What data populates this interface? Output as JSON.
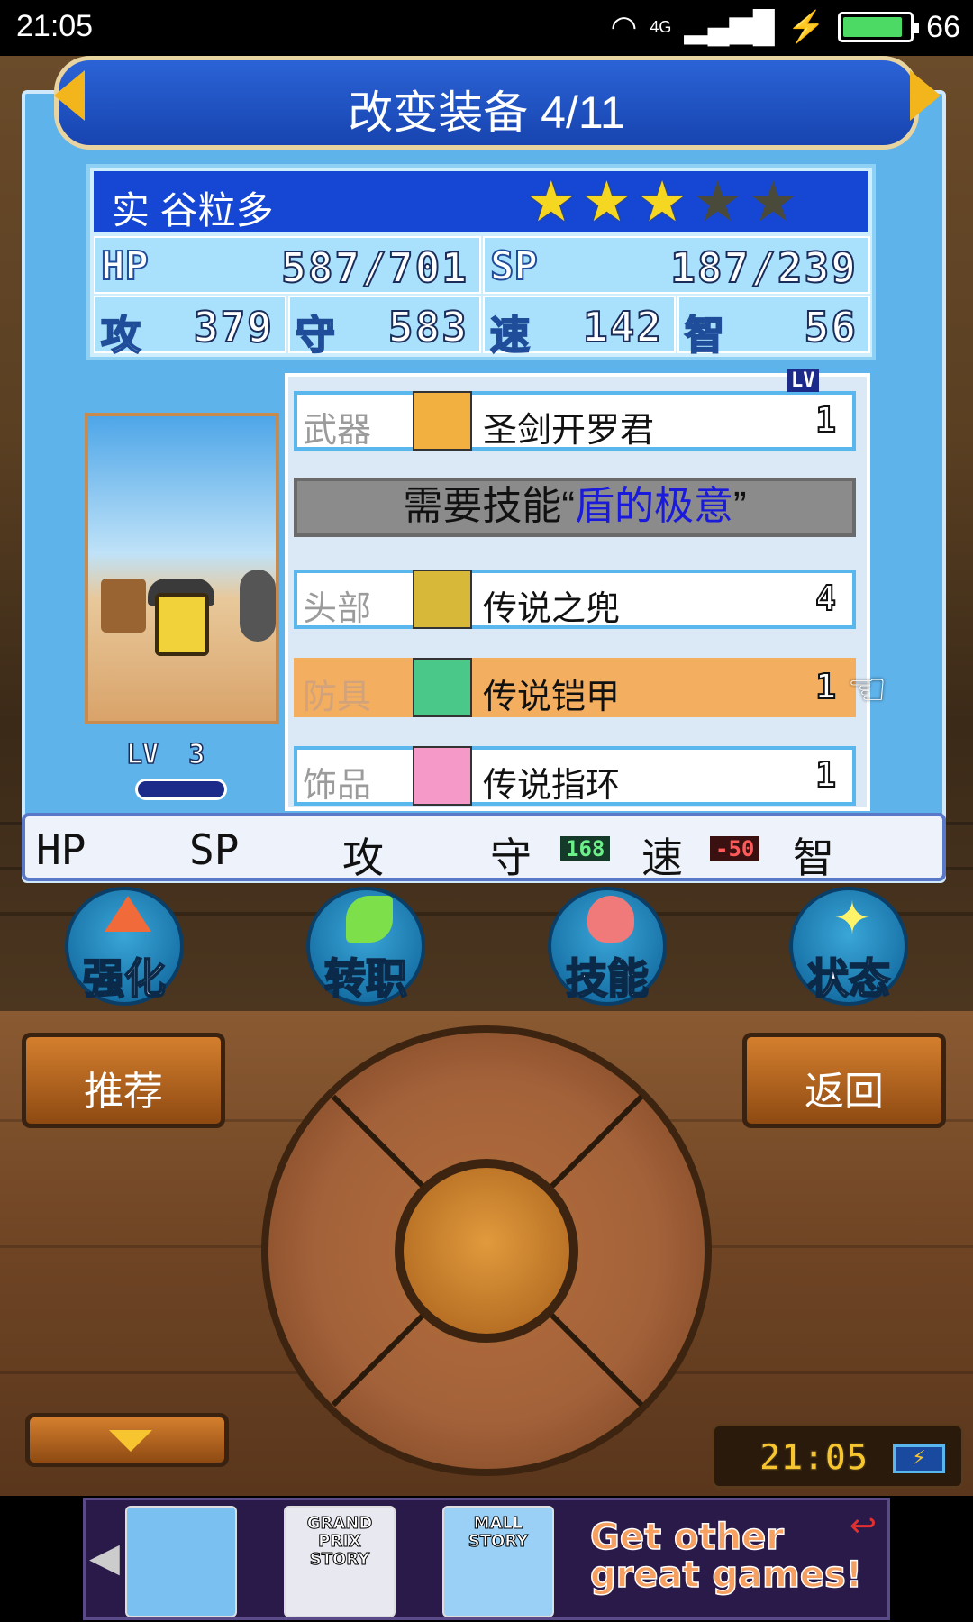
{
  "status_bar": {
    "time": "21:05",
    "battery": "66",
    "network": "4G",
    "battery_fill_pct": 90
  },
  "header": {
    "title": "改变装备 4/11"
  },
  "character": {
    "name": "实 谷粒多",
    "stars_filled": 3,
    "stars_total": 5,
    "hp_label": "HP",
    "hp": "587/701",
    "sp_label": "SP",
    "sp": "187/239",
    "atk_label": "攻",
    "atk": "379",
    "def_label": "守",
    "def": "583",
    "spd_label": "速",
    "spd": "142",
    "int_label": "智",
    "int": "56",
    "lv_label": "LV",
    "lv": "3"
  },
  "equipment": {
    "lv_tag": "LV",
    "weapon": {
      "slot": "武器",
      "name": "圣剑开罗君",
      "lv": "1",
      "icon": "sword-icon"
    },
    "skill_requirement": {
      "prefix": "需要技能“",
      "skill": "盾的极意",
      "suffix": "”"
    },
    "head": {
      "slot": "头部",
      "name": "传说之兜",
      "lv": "4",
      "icon": "helmet-icon"
    },
    "armor": {
      "slot": "防具",
      "name": "传说铠甲",
      "lv": "1",
      "icon": "armor-icon",
      "selected": true
    },
    "accessory": {
      "slot": "饰品",
      "name": "传说指环",
      "lv": "1",
      "icon": "ring-icon"
    }
  },
  "compare": {
    "hp": "HP",
    "sp": "SP",
    "atk": "攻",
    "def": "守",
    "def_delta": "168",
    "spd": "速",
    "spd_delta": "-50",
    "int": "智"
  },
  "actions": [
    {
      "label": "强化",
      "icon": "arrow-up-icon"
    },
    {
      "label": "转职",
      "icon": "leaf-icon"
    },
    {
      "label": "技能",
      "icon": "flame-icon"
    },
    {
      "label": "状态",
      "icon": "sparkle-icon"
    }
  ],
  "controller": {
    "recommend": "推荐",
    "back": "返回",
    "clock": "21:05"
  },
  "ad": {
    "games": [
      "GRAND PRIX STORY",
      "MALL STORY"
    ],
    "cta": "Get other great games!"
  },
  "colors": {
    "selected_row": "#f3ae60",
    "title_bar": "#1744b0",
    "star_on": "#f5d621",
    "skill_name": "#1a1adb"
  }
}
